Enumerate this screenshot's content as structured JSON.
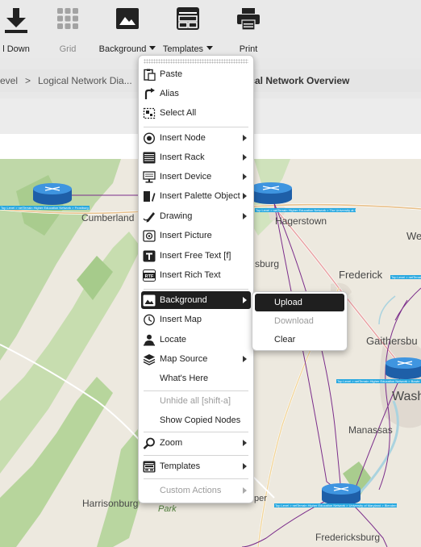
{
  "toolbar": {
    "items": [
      {
        "label": "l Down",
        "icon": "download-icon"
      },
      {
        "label": "Grid",
        "icon": "grid-icon",
        "disabled": true
      },
      {
        "label": "Background",
        "icon": "image-icon",
        "dropdown": true
      },
      {
        "label": "Templates",
        "icon": "templates-icon",
        "dropdown": true
      },
      {
        "label": "Print",
        "icon": "printer-icon"
      }
    ]
  },
  "breadcrumb": {
    "level": "evel",
    "separator": ">",
    "current": "Logical Network Dia...",
    "title": "ical Network Overview"
  },
  "map": {
    "places": [
      "Cumberland",
      "Hagerstown",
      "Frederick",
      "Gaithersbu",
      "Wash",
      "Manassas",
      "Harrisonburg",
      "Fredericksburg",
      "We",
      "sburg",
      "Park",
      "per"
    ],
    "node_labels": [
      "Top Level > netTerrain Higher Education Network > Frostburg",
      "Top Level > netTerrain Higher Education Network > The University at Shady Grove > A1",
      "Top Level > netTerrain Higher Education Network > ...",
      "Top Level > netTerrain Higher Education Network > Bowie",
      "Top Level > netTerrain Higher Education Network > University of Maryland > Blenden"
    ]
  },
  "context_menu": {
    "items": [
      {
        "label": "Paste",
        "icon": "clipboard-icon"
      },
      {
        "label": "Alias",
        "icon": "alias-arrow-icon"
      },
      {
        "label": "Select All",
        "icon": "select-all-icon"
      },
      {
        "label": "Insert Node",
        "icon": "node-icon",
        "submenu": true
      },
      {
        "label": "Insert Rack",
        "icon": "rack-icon",
        "submenu": true
      },
      {
        "label": "Insert Device",
        "icon": "device-icon",
        "submenu": true
      },
      {
        "label": "Insert Palette Object",
        "icon": "palette-object-icon",
        "submenu": true
      },
      {
        "label": "Drawing",
        "icon": "pencil-icon",
        "submenu": true
      },
      {
        "label": "Insert Picture",
        "icon": "picture-icon"
      },
      {
        "label": "Insert Free Text [f]",
        "icon": "text-icon"
      },
      {
        "label": "Insert Rich Text",
        "icon": "rich-text-icon"
      },
      {
        "label": "Background",
        "icon": "image-icon",
        "submenu": true,
        "active": true
      },
      {
        "label": "Insert Map",
        "icon": "map-clock-icon"
      },
      {
        "label": "Locate",
        "icon": "locate-icon"
      },
      {
        "label": "Map Source",
        "icon": "layers-icon",
        "submenu": true
      },
      {
        "label": "What's Here",
        "icon": ""
      },
      {
        "label": "Unhide all [shift-a]",
        "icon": "",
        "disabled": true
      },
      {
        "label": "Show Copied Nodes",
        "icon": ""
      },
      {
        "label": "Zoom",
        "icon": "zoom-icon",
        "submenu": true
      },
      {
        "label": "Templates",
        "icon": "templates-icon",
        "submenu": true
      },
      {
        "label": "Custom Actions",
        "icon": "",
        "submenu": true,
        "disabled": true
      }
    ]
  },
  "submenu": {
    "items": [
      {
        "label": "Upload",
        "active": true
      },
      {
        "label": "Download",
        "disabled": true
      },
      {
        "label": "Clear"
      }
    ]
  },
  "colors": {
    "menu_highlight": "#1f1f1f",
    "node_label_bg": "#27a8e0",
    "network_link": "#7b2d8b",
    "router_blue": "#2f7fd1"
  }
}
